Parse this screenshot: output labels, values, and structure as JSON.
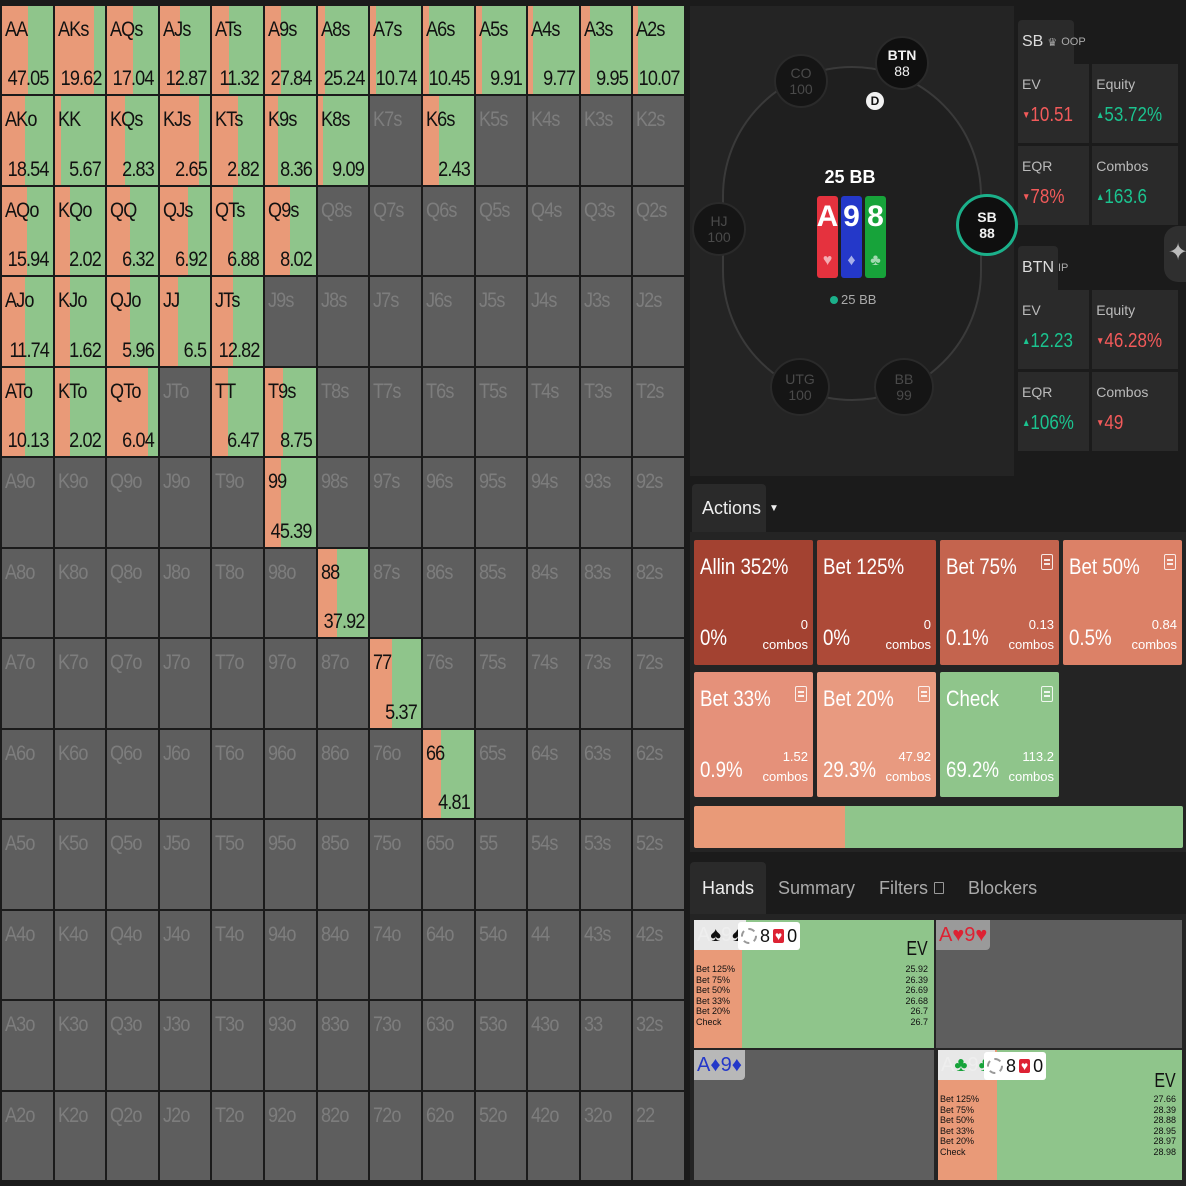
{
  "matrix": {
    "rows": [
      [
        {
          "h": "AA",
          "v": "47.05",
          "r": 0.52
        },
        {
          "h": "AKs",
          "v": "19.62",
          "r": 0.78
        },
        {
          "h": "AQs",
          "v": "17.04",
          "r": 0.5
        },
        {
          "h": "AJs",
          "v": "12.87",
          "r": 0.4
        },
        {
          "h": "ATs",
          "v": "11.32",
          "r": 0.32
        },
        {
          "h": "A9s",
          "v": "27.84",
          "r": 0.32
        },
        {
          "h": "A8s",
          "v": "25.24",
          "r": 0.15
        },
        {
          "h": "A7s",
          "v": "10.74",
          "r": 0.12
        },
        {
          "h": "A6s",
          "v": "10.45",
          "r": 0.12
        },
        {
          "h": "A5s",
          "v": "9.91",
          "r": 0.12
        },
        {
          "h": "A4s",
          "v": "9.77",
          "r": 0.1
        },
        {
          "h": "A3s",
          "v": "9.95",
          "r": 0.18
        },
        {
          "h": "A2s",
          "v": "10.07",
          "r": 0.1
        }
      ],
      [
        {
          "h": "AKo",
          "v": "18.54",
          "r": 0.45
        },
        {
          "h": "KK",
          "v": "5.67",
          "r": 0.12
        },
        {
          "h": "KQs",
          "v": "2.83",
          "r": 0.35
        },
        {
          "h": "KJs",
          "v": "2.65",
          "r": 0.78
        },
        {
          "h": "KTs",
          "v": "2.82",
          "r": 0.5
        },
        {
          "h": "K9s",
          "v": "8.36",
          "r": 0.25
        },
        {
          "h": "K8s",
          "v": "9.09",
          "r": 0.1
        },
        {
          "h": "K7s",
          "v": "",
          "r": -1
        },
        {
          "h": "K6s",
          "v": "2.43",
          "r": 0.32
        },
        {
          "h": "K5s",
          "v": "",
          "r": -1
        },
        {
          "h": "K4s",
          "v": "",
          "r": -1
        },
        {
          "h": "K3s",
          "v": "",
          "r": -1
        },
        {
          "h": "K2s",
          "v": "",
          "r": -1
        }
      ],
      [
        {
          "h": "AQo",
          "v": "15.94",
          "r": 0.5
        },
        {
          "h": "KQo",
          "v": "2.02",
          "r": 0.3
        },
        {
          "h": "QQ",
          "v": "6.32",
          "r": 0.45
        },
        {
          "h": "QJs",
          "v": "6.92",
          "r": 0.55
        },
        {
          "h": "QTs",
          "v": "6.88",
          "r": 0.4
        },
        {
          "h": "Q9s",
          "v": "8.02",
          "r": 0.5
        },
        {
          "h": "Q8s",
          "v": "",
          "r": -1
        },
        {
          "h": "Q7s",
          "v": "",
          "r": -1
        },
        {
          "h": "Q6s",
          "v": "",
          "r": -1
        },
        {
          "h": "Q5s",
          "v": "",
          "r": -1
        },
        {
          "h": "Q4s",
          "v": "",
          "r": -1
        },
        {
          "h": "Q3s",
          "v": "",
          "r": -1
        },
        {
          "h": "Q2s",
          "v": "",
          "r": -1
        }
      ],
      [
        {
          "h": "AJo",
          "v": "11.74",
          "r": 0.45
        },
        {
          "h": "KJo",
          "v": "1.62",
          "r": 0.3
        },
        {
          "h": "QJo",
          "v": "5.96",
          "r": 0.45
        },
        {
          "h": "JJ",
          "v": "6.5",
          "r": 0.35
        },
        {
          "h": "JTs",
          "v": "12.82",
          "r": 0.4
        },
        {
          "h": "J9s",
          "v": "",
          "r": -1
        },
        {
          "h": "J8s",
          "v": "",
          "r": -1
        },
        {
          "h": "J7s",
          "v": "",
          "r": -1
        },
        {
          "h": "J6s",
          "v": "",
          "r": -1
        },
        {
          "h": "J5s",
          "v": "",
          "r": -1
        },
        {
          "h": "J4s",
          "v": "",
          "r": -1
        },
        {
          "h": "J3s",
          "v": "",
          "r": -1
        },
        {
          "h": "J2s",
          "v": "",
          "r": -1
        }
      ],
      [
        {
          "h": "ATo",
          "v": "10.13",
          "r": 0.45
        },
        {
          "h": "KTo",
          "v": "2.02",
          "r": 0.3
        },
        {
          "h": "QTo",
          "v": "6.04",
          "r": 0.8
        },
        {
          "h": "JTo",
          "v": "",
          "r": -1
        },
        {
          "h": "TT",
          "v": "6.47",
          "r": 0.3
        },
        {
          "h": "T9s",
          "v": "8.75",
          "r": 0.35
        },
        {
          "h": "T8s",
          "v": "",
          "r": -1
        },
        {
          "h": "T7s",
          "v": "",
          "r": -1
        },
        {
          "h": "T6s",
          "v": "",
          "r": -1
        },
        {
          "h": "T5s",
          "v": "",
          "r": -1
        },
        {
          "h": "T4s",
          "v": "",
          "r": -1
        },
        {
          "h": "T3s",
          "v": "",
          "r": -1
        },
        {
          "h": "T2s",
          "v": "",
          "r": -1
        }
      ],
      [
        {
          "h": "A9o",
          "v": "",
          "r": -1
        },
        {
          "h": "K9o",
          "v": "",
          "r": -1
        },
        {
          "h": "Q9o",
          "v": "",
          "r": -1
        },
        {
          "h": "J9o",
          "v": "",
          "r": -1
        },
        {
          "h": "T9o",
          "v": "",
          "r": -1
        },
        {
          "h": "99",
          "v": "45.39",
          "r": 0.32
        },
        {
          "h": "98s",
          "v": "",
          "r": -1
        },
        {
          "h": "97s",
          "v": "",
          "r": -1
        },
        {
          "h": "96s",
          "v": "",
          "r": -1
        },
        {
          "h": "95s",
          "v": "",
          "r": -1
        },
        {
          "h": "94s",
          "v": "",
          "r": -1
        },
        {
          "h": "93s",
          "v": "",
          "r": -1
        },
        {
          "h": "92s",
          "v": "",
          "r": -1
        }
      ],
      [
        {
          "h": "A8o",
          "v": "",
          "r": -1
        },
        {
          "h": "K8o",
          "v": "",
          "r": -1
        },
        {
          "h": "Q8o",
          "v": "",
          "r": -1
        },
        {
          "h": "J8o",
          "v": "",
          "r": -1
        },
        {
          "h": "T8o",
          "v": "",
          "r": -1
        },
        {
          "h": "98o",
          "v": "",
          "r": -1
        },
        {
          "h": "88",
          "v": "37.92",
          "r": 0.38
        },
        {
          "h": "87s",
          "v": "",
          "r": -1
        },
        {
          "h": "86s",
          "v": "",
          "r": -1
        },
        {
          "h": "85s",
          "v": "",
          "r": -1
        },
        {
          "h": "84s",
          "v": "",
          "r": -1
        },
        {
          "h": "83s",
          "v": "",
          "r": -1
        },
        {
          "h": "82s",
          "v": "",
          "r": -1
        }
      ],
      [
        {
          "h": "A7o",
          "v": "",
          "r": -1
        },
        {
          "h": "K7o",
          "v": "",
          "r": -1
        },
        {
          "h": "Q7o",
          "v": "",
          "r": -1
        },
        {
          "h": "J7o",
          "v": "",
          "r": -1
        },
        {
          "h": "T7o",
          "v": "",
          "r": -1
        },
        {
          "h": "97o",
          "v": "",
          "r": -1
        },
        {
          "h": "87o",
          "v": "",
          "r": -1
        },
        {
          "h": "77",
          "v": "5.37",
          "r": 0.42
        },
        {
          "h": "76s",
          "v": "",
          "r": -1
        },
        {
          "h": "75s",
          "v": "",
          "r": -1
        },
        {
          "h": "74s",
          "v": "",
          "r": -1
        },
        {
          "h": "73s",
          "v": "",
          "r": -1
        },
        {
          "h": "72s",
          "v": "",
          "r": -1
        }
      ],
      [
        {
          "h": "A6o",
          "v": "",
          "r": -1
        },
        {
          "h": "K6o",
          "v": "",
          "r": -1
        },
        {
          "h": "Q6o",
          "v": "",
          "r": -1
        },
        {
          "h": "J6o",
          "v": "",
          "r": -1
        },
        {
          "h": "T6o",
          "v": "",
          "r": -1
        },
        {
          "h": "96o",
          "v": "",
          "r": -1
        },
        {
          "h": "86o",
          "v": "",
          "r": -1
        },
        {
          "h": "76o",
          "v": "",
          "r": -1
        },
        {
          "h": "66",
          "v": "4.81",
          "r": 0.35
        },
        {
          "h": "65s",
          "v": "",
          "r": -1
        },
        {
          "h": "64s",
          "v": "",
          "r": -1
        },
        {
          "h": "63s",
          "v": "",
          "r": -1
        },
        {
          "h": "62s",
          "v": "",
          "r": -1
        }
      ],
      [
        {
          "h": "A5o",
          "v": "",
          "r": -1
        },
        {
          "h": "K5o",
          "v": "",
          "r": -1
        },
        {
          "h": "Q5o",
          "v": "",
          "r": -1
        },
        {
          "h": "J5o",
          "v": "",
          "r": -1
        },
        {
          "h": "T5o",
          "v": "",
          "r": -1
        },
        {
          "h": "95o",
          "v": "",
          "r": -1
        },
        {
          "h": "85o",
          "v": "",
          "r": -1
        },
        {
          "h": "75o",
          "v": "",
          "r": -1
        },
        {
          "h": "65o",
          "v": "",
          "r": -1
        },
        {
          "h": "55",
          "v": "",
          "r": -1
        },
        {
          "h": "54s",
          "v": "",
          "r": -1
        },
        {
          "h": "53s",
          "v": "",
          "r": -1
        },
        {
          "h": "52s",
          "v": "",
          "r": -1
        }
      ],
      [
        {
          "h": "A4o",
          "v": "",
          "r": -1
        },
        {
          "h": "K4o",
          "v": "",
          "r": -1
        },
        {
          "h": "Q4o",
          "v": "",
          "r": -1
        },
        {
          "h": "J4o",
          "v": "",
          "r": -1
        },
        {
          "h": "T4o",
          "v": "",
          "r": -1
        },
        {
          "h": "94o",
          "v": "",
          "r": -1
        },
        {
          "h": "84o",
          "v": "",
          "r": -1
        },
        {
          "h": "74o",
          "v": "",
          "r": -1
        },
        {
          "h": "64o",
          "v": "",
          "r": -1
        },
        {
          "h": "54o",
          "v": "",
          "r": -1
        },
        {
          "h": "44",
          "v": "",
          "r": -1
        },
        {
          "h": "43s",
          "v": "",
          "r": -1
        },
        {
          "h": "42s",
          "v": "",
          "r": -1
        }
      ],
      [
        {
          "h": "A3o",
          "v": "",
          "r": -1
        },
        {
          "h": "K3o",
          "v": "",
          "r": -1
        },
        {
          "h": "Q3o",
          "v": "",
          "r": -1
        },
        {
          "h": "J3o",
          "v": "",
          "r": -1
        },
        {
          "h": "T3o",
          "v": "",
          "r": -1
        },
        {
          "h": "93o",
          "v": "",
          "r": -1
        },
        {
          "h": "83o",
          "v": "",
          "r": -1
        },
        {
          "h": "73o",
          "v": "",
          "r": -1
        },
        {
          "h": "63o",
          "v": "",
          "r": -1
        },
        {
          "h": "53o",
          "v": "",
          "r": -1
        },
        {
          "h": "43o",
          "v": "",
          "r": -1
        },
        {
          "h": "33",
          "v": "",
          "r": -1
        },
        {
          "h": "32s",
          "v": "",
          "r": -1
        }
      ],
      [
        {
          "h": "A2o",
          "v": "",
          "r": -1
        },
        {
          "h": "K2o",
          "v": "",
          "r": -1
        },
        {
          "h": "Q2o",
          "v": "",
          "r": -1
        },
        {
          "h": "J2o",
          "v": "",
          "r": -1
        },
        {
          "h": "T2o",
          "v": "",
          "r": -1
        },
        {
          "h": "92o",
          "v": "",
          "r": -1
        },
        {
          "h": "82o",
          "v": "",
          "r": -1
        },
        {
          "h": "72o",
          "v": "",
          "r": -1
        },
        {
          "h": "62o",
          "v": "",
          "r": -1
        },
        {
          "h": "52o",
          "v": "",
          "r": -1
        },
        {
          "h": "42o",
          "v": "",
          "r": -1
        },
        {
          "h": "32o",
          "v": "",
          "r": -1
        },
        {
          "h": "22",
          "v": "",
          "r": -1
        }
      ]
    ]
  },
  "table": {
    "seats": {
      "co": {
        "pos": "CO",
        "stack": "100"
      },
      "btn": {
        "pos": "BTN",
        "stack": "88"
      },
      "hj": {
        "pos": "HJ",
        "stack": "100"
      },
      "sb": {
        "pos": "SB",
        "stack": "88"
      },
      "utg": {
        "pos": "UTG",
        "stack": "100"
      },
      "bb": {
        "pos": "BB",
        "stack": "99"
      }
    },
    "dealer": "D",
    "pot": "25 BB",
    "stack_note": "25 BB",
    "board": [
      {
        "rank": "A",
        "suit": "♥",
        "color": "#e5323e"
      },
      {
        "rank": "9",
        "suit": "♦",
        "color": "#2438c9"
      },
      {
        "rank": "8",
        "suit": "♣",
        "color": "#17a33a"
      }
    ]
  },
  "stats": {
    "oop": {
      "title": "SB",
      "crown": "♛",
      "tag": "OOP",
      "ev_label": "EV",
      "ev": "10.51",
      "ev_dir": "down",
      "equity_label": "Equity",
      "equity": "53.72%",
      "equity_dir": "up",
      "eqr_label": "EQR",
      "eqr": "78%",
      "eqr_dir": "down",
      "combos_label": "Combos",
      "combos": "163.6",
      "combos_dir": "up"
    },
    "ip": {
      "title": "BTN",
      "tag": "IP",
      "ev_label": "EV",
      "ev": "12.23",
      "ev_dir": "up",
      "equity_label": "Equity",
      "equity": "46.28%",
      "equity_dir": "down",
      "eqr_label": "EQR",
      "eqr": "106%",
      "eqr_dir": "up",
      "combos_label": "Combos",
      "combos": "49",
      "combos_dir": "down"
    }
  },
  "actions": {
    "tab_label": "Actions",
    "items": [
      {
        "label": "Allin 352%",
        "freq": "0%",
        "combos": "0",
        "unit": "combos",
        "color": "#a34231",
        "icon": false
      },
      {
        "label": "Bet 125%",
        "freq": "0%",
        "combos": "0",
        "unit": "combos",
        "color": "#ad4a38",
        "icon": false
      },
      {
        "label": "Bet 75%",
        "freq": "0.1%",
        "combos": "0.13",
        "unit": "combos",
        "color": "#c4644e",
        "icon": true
      },
      {
        "label": "Bet 50%",
        "freq": "0.5%",
        "combos": "0.84",
        "unit": "combos",
        "color": "#dc8167",
        "icon": true
      },
      {
        "label": "Bet 33%",
        "freq": "0.9%",
        "combos": "1.52",
        "unit": "combos",
        "color": "#e5917a",
        "icon": true
      },
      {
        "label": "Bet 20%",
        "freq": "29.3%",
        "combos": "47.92",
        "unit": "combos",
        "color": "#e89a80",
        "icon": true
      },
      {
        "label": "Check",
        "freq": "69.2%",
        "combos": "113.2",
        "unit": "combos",
        "color": "#8fc58b",
        "icon": true
      }
    ],
    "freq_bar": {
      "bet_share": 0.308,
      "bet_color": "#e99a78",
      "check_color": "#8fc58b"
    }
  },
  "hands_tabs": [
    "Hands",
    "Summary",
    "Filters",
    "Blockers"
  ],
  "hands": {
    "h1": {
      "r1": "A",
      "s1": "♠",
      "r2": "9",
      "s2": "♠",
      "c1": "#111",
      "c2": "#111",
      "blk_num": "8",
      "blk_zero": "0",
      "ev": "EV",
      "lines": [
        "Bet 125%",
        "Bet 75%",
        "Bet 50%",
        "Bet 33%",
        "Bet 20%",
        "Check"
      ],
      "vals": [
        "25.92",
        "26.39",
        "26.69",
        "26.68",
        "26.7",
        "26.7"
      ],
      "bet_share": 0.2
    },
    "h2": {
      "r1": "A",
      "s1": "♥",
      "r2": "9",
      "s2": "♥",
      "c1": "#d23",
      "c2": "#d23"
    },
    "h3": {
      "r1": "A",
      "s1": "♦",
      "r2": "9",
      "s2": "♦",
      "c1": "#2438c9",
      "c2": "#2438c9"
    },
    "h4": {
      "r1": "A",
      "s1": "♣",
      "r2": "9",
      "s2": "♣",
      "c1": "#17a33a",
      "c2": "#17a33a",
      "blk_num": "8",
      "blk_zero": "0",
      "ev": "EV",
      "lines": [
        "Bet 125%",
        "Bet 75%",
        "Bet 50%",
        "Bet 33%",
        "Bet 20%",
        "Check"
      ],
      "vals": [
        "27.66",
        "28.39",
        "28.88",
        "28.95",
        "28.97",
        "28.98"
      ],
      "bet_share": 0.24
    }
  }
}
